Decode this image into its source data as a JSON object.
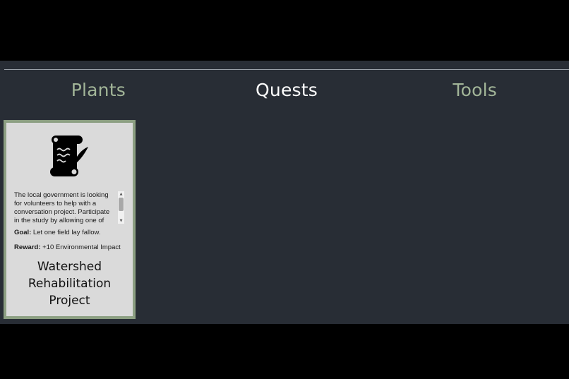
{
  "tabs": [
    {
      "label": "Plants",
      "active": false
    },
    {
      "label": "Quests",
      "active": true
    },
    {
      "label": "Tools",
      "active": false
    }
  ],
  "colors": {
    "background": "#282d35",
    "tab_inactive": "#a2b598",
    "tab_active": "#ffffff",
    "card_bg": "#dadada",
    "card_border": "#8c9f82"
  },
  "quest_card": {
    "icon": "scroll-quill-icon",
    "description": "The local government is looking for volunteers to help with a conversation project. Participate in the study by allowing one of your",
    "goal_label": "Goal:",
    "goal_value": "Let one field lay fallow.",
    "reward_label": "Reward:",
    "reward_value": "+10 Environmental Impact",
    "title": "Watershed Rehabilitation Project"
  }
}
